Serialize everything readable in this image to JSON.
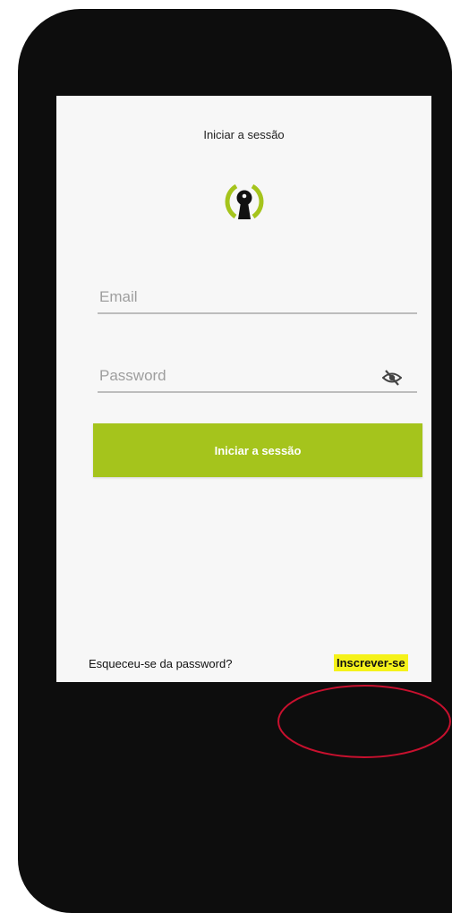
{
  "header": {
    "title": "Iniciar a sessão"
  },
  "form": {
    "email_placeholder": "Email",
    "password_placeholder": "Password",
    "login_label": "Iniciar a sessão"
  },
  "footer": {
    "forgot_label": "Esqueceu-se da password?",
    "signup_label": "Inscrever-se"
  },
  "icons": {
    "logo": "keyhole-signal-icon",
    "password_toggle": "eye-off-icon"
  },
  "colors": {
    "accent": "#a5c41c",
    "highlight": "#f5f21a",
    "annotation": "#c8102e"
  }
}
